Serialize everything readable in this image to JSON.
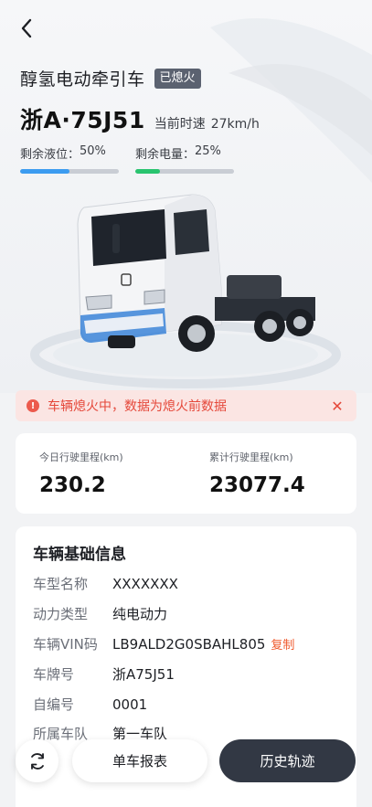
{
  "header": {
    "back_icon": "chevron-left-icon",
    "vehicle_type": "醇氢电动牵引车",
    "status_badge": "已熄火",
    "plate": "浙A·75J51",
    "speed_label": "当前时速",
    "speed_value": "27km/h"
  },
  "gauges": [
    {
      "label": "剩余液位：",
      "value": "50%",
      "percent": 50,
      "color": "#3c9cf0"
    },
    {
      "label": "剩余电量：",
      "value": "25%",
      "percent": 25,
      "color": "#29c46f"
    }
  ],
  "alert": {
    "icon": "alert-icon",
    "text": "车辆熄火中，数据为熄火前数据",
    "close_icon": "close-icon",
    "color": "#e5483a"
  },
  "mileage": {
    "today_label": "今日行驶里程(km)",
    "today_value": "230.2",
    "total_label": "累计行驶里程(km)",
    "total_value": "23077.4"
  },
  "info": {
    "title": "车辆基础信息",
    "rows": [
      {
        "key": "车型名称",
        "value": "XXXXXXX"
      },
      {
        "key": "动力类型",
        "value": "纯电动力"
      },
      {
        "key": "车辆VIN码",
        "value": "LB9ALD2G0SBAHL805",
        "action": "复制"
      },
      {
        "key": "车牌号",
        "value": "浙A75J51"
      },
      {
        "key": "自编号",
        "value": "0001"
      },
      {
        "key": "所属车队",
        "value": "第一车队"
      }
    ]
  },
  "bottom": {
    "refresh_icon": "refresh-icon",
    "report_label": "单车报表",
    "history_label": "历史轨迹"
  }
}
